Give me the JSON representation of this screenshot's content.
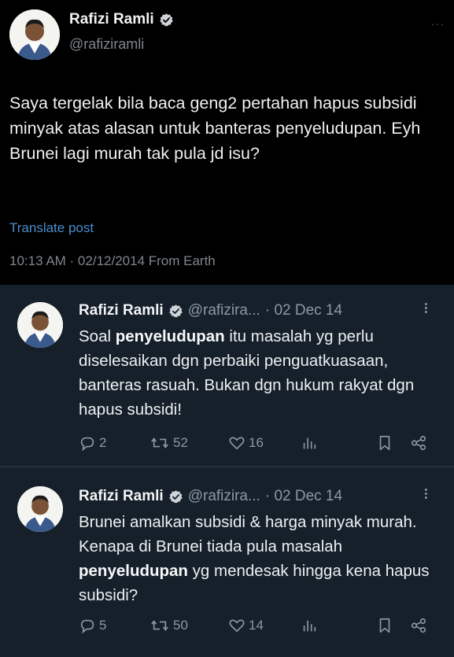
{
  "post": {
    "name": "Rafizi Ramli",
    "handle": "@rafiziramli",
    "more": "···",
    "text": "Saya tergelak bila baca geng2 pertahan hapus subsidi minyak atas alasan untuk banteras penyeludupan. Eyh Brunei lagi murah tak pula jd isu?",
    "translate": "Translate post",
    "timestamp": "10:13 AM · 02/12/2014 From Earth"
  },
  "replies": [
    {
      "name": "Rafizi Ramli",
      "handle": "@rafizira...",
      "date": "· 02 Dec 14",
      "text_parts": [
        "Soal ",
        "penyeludupan",
        " itu masalah yg perlu diselesaikan dgn perbaiki penguatkuasaan, banteras rasuah. Bukan dgn hukum rakyat dgn hapus subsidi!"
      ],
      "replies_count": "2",
      "retweets": "52",
      "likes": "16"
    },
    {
      "name": "Rafizi Ramli",
      "handle": "@rafizira...",
      "date": "· 02 Dec 14",
      "text_parts": [
        "Brunei amalkan subsidi & harga minyak murah. Kenapa di Brunei tiada pula masalah ",
        "penyeludupan",
        " yg mendesak hingga kena hapus subsidi?"
      ],
      "replies_count": "5",
      "retweets": "50",
      "likes": "14"
    }
  ],
  "colors": {
    "verified": "#cfd4d8",
    "link": "#4a8ecf",
    "muted": "#8b98a5",
    "reply_bg": "#15202b"
  }
}
